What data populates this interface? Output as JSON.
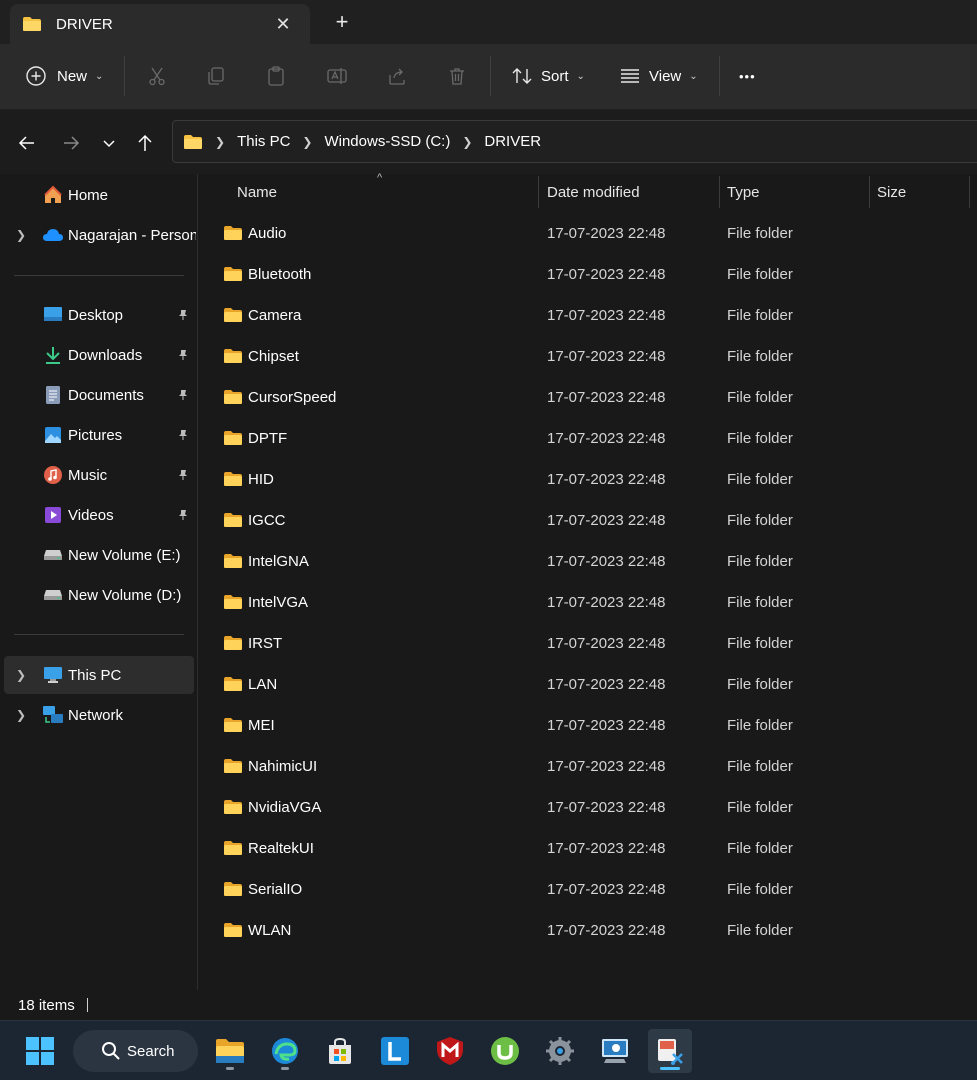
{
  "tab": {
    "title": "DRIVER",
    "close_glyph": "✕",
    "new_tab_glyph": "+"
  },
  "toolbar": {
    "new_label": "New",
    "sort_label": "Sort",
    "view_label": "View",
    "more_glyph": "•••"
  },
  "breadcrumb": [
    "This PC",
    "Windows-SSD (C:)",
    "DRIVER"
  ],
  "sidebar": {
    "items": [
      {
        "label": "Home",
        "icon": "home-icon"
      },
      {
        "label": "Nagarajan - Personal",
        "icon": "onedrive-icon"
      },
      {
        "label": "Desktop",
        "icon": "desktop-icon"
      },
      {
        "label": "Downloads",
        "icon": "downloads-icon"
      },
      {
        "label": "Documents",
        "icon": "documents-icon"
      },
      {
        "label": "Pictures",
        "icon": "pictures-icon"
      },
      {
        "label": "Music",
        "icon": "music-icon"
      },
      {
        "label": "Videos",
        "icon": "videos-icon"
      },
      {
        "label": "New Volume (E:)",
        "icon": "drive-icon"
      },
      {
        "label": "New Volume (D:)",
        "icon": "drive-icon"
      },
      {
        "label": "This PC",
        "icon": "this-pc-icon"
      },
      {
        "label": "Network",
        "icon": "network-icon"
      }
    ]
  },
  "columns": {
    "name": "Name",
    "date": "Date modified",
    "type": "Type",
    "size": "Size"
  },
  "files": [
    {
      "name": "Audio",
      "date": "17-07-2023 22:48",
      "type": "File folder",
      "size": ""
    },
    {
      "name": "Bluetooth",
      "date": "17-07-2023 22:48",
      "type": "File folder",
      "size": ""
    },
    {
      "name": "Camera",
      "date": "17-07-2023 22:48",
      "type": "File folder",
      "size": ""
    },
    {
      "name": "Chipset",
      "date": "17-07-2023 22:48",
      "type": "File folder",
      "size": ""
    },
    {
      "name": "CursorSpeed",
      "date": "17-07-2023 22:48",
      "type": "File folder",
      "size": ""
    },
    {
      "name": "DPTF",
      "date": "17-07-2023 22:48",
      "type": "File folder",
      "size": ""
    },
    {
      "name": "HID",
      "date": "17-07-2023 22:48",
      "type": "File folder",
      "size": ""
    },
    {
      "name": "IGCC",
      "date": "17-07-2023 22:48",
      "type": "File folder",
      "size": ""
    },
    {
      "name": "IntelGNA",
      "date": "17-07-2023 22:48",
      "type": "File folder",
      "size": ""
    },
    {
      "name": "IntelVGA",
      "date": "17-07-2023 22:48",
      "type": "File folder",
      "size": ""
    },
    {
      "name": "IRST",
      "date": "17-07-2023 22:48",
      "type": "File folder",
      "size": ""
    },
    {
      "name": "LAN",
      "date": "17-07-2023 22:48",
      "type": "File folder",
      "size": ""
    },
    {
      "name": "MEI",
      "date": "17-07-2023 22:48",
      "type": "File folder",
      "size": ""
    },
    {
      "name": "NahimicUI",
      "date": "17-07-2023 22:48",
      "type": "File folder",
      "size": ""
    },
    {
      "name": "NvidiaVGA",
      "date": "17-07-2023 22:48",
      "type": "File folder",
      "size": ""
    },
    {
      "name": "RealtekUI",
      "date": "17-07-2023 22:48",
      "type": "File folder",
      "size": ""
    },
    {
      "name": "SerialIO",
      "date": "17-07-2023 22:48",
      "type": "File folder",
      "size": ""
    },
    {
      "name": "WLAN",
      "date": "17-07-2023 22:48",
      "type": "File folder",
      "size": ""
    }
  ],
  "status": {
    "item_count": "18 items"
  },
  "taskbar": {
    "search_label": "Search",
    "apps": [
      "file-explorer-icon",
      "edge-icon",
      "store-icon",
      "lens-icon",
      "mcafee-icon",
      "utorrent-icon",
      "settings-icon",
      "remote-desktop-icon",
      "snipping-tool-icon"
    ]
  },
  "colors": {
    "folder_yellow": "#f5c242",
    "accent": "#4cc2ff",
    "background": "#191919"
  }
}
